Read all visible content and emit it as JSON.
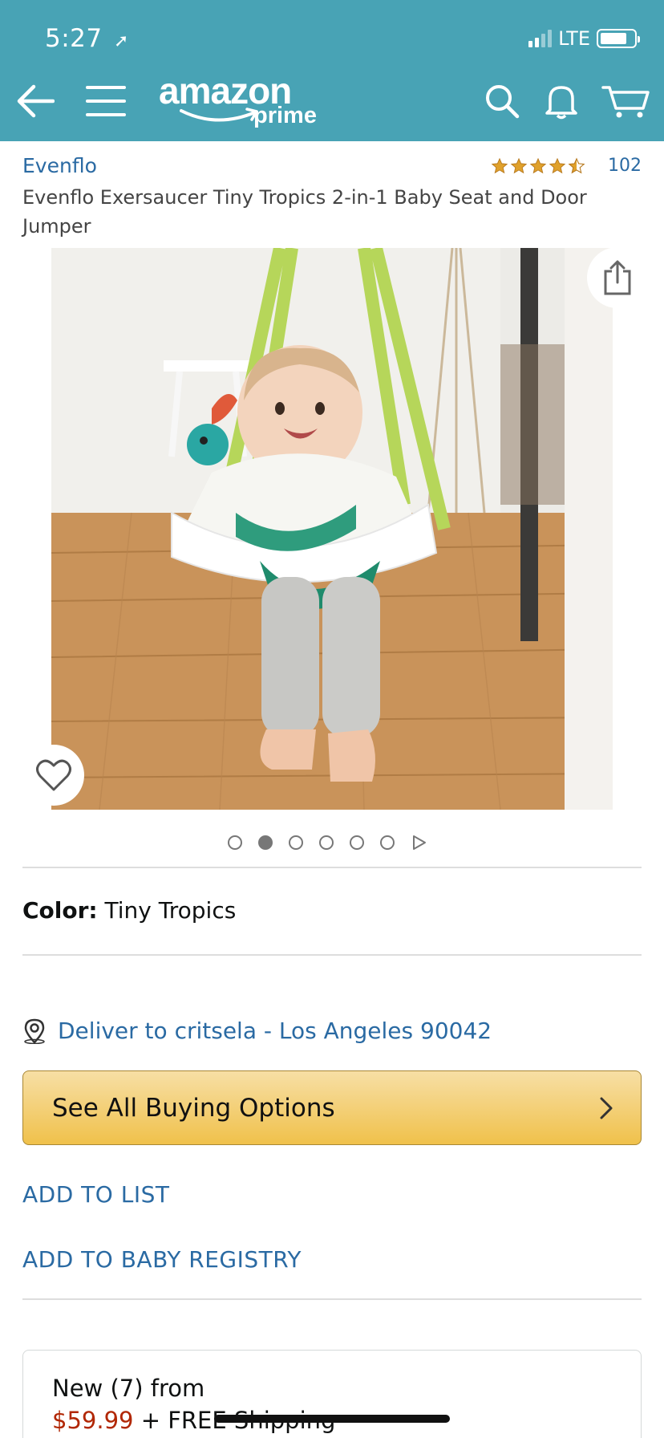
{
  "status_bar": {
    "time": "5:27",
    "location_arrow": "location-arrow-icon",
    "network": "LTE"
  },
  "nav": {
    "back_icon": "back-arrow-icon",
    "menu_icon": "hamburger-menu-icon",
    "logo_text": "amazon",
    "logo_sub": "prime",
    "search_icon": "search-icon",
    "bell_icon": "bell-icon",
    "cart_icon": "cart-icon"
  },
  "product": {
    "brand": "Evenflo",
    "rating": 4.5,
    "rating_count": "102",
    "title": "Evenflo Exersaucer Tiny Tropics 2-in-1 Baby Seat and Door Jumper",
    "image_count": 6,
    "active_image_index": 1
  },
  "color": {
    "label": "Color:",
    "value": "Tiny Tropics"
  },
  "delivery": {
    "text": "Deliver to critsela - Los Angeles 90042"
  },
  "buttons": {
    "buying_options": "See All Buying Options",
    "add_to_list": "ADD TO LIST",
    "add_to_registry": "ADD TO BABY REGISTRY"
  },
  "offer": {
    "line1": "New (7) from",
    "price": "$59.99",
    "shipping": "+ FREE Shipping"
  },
  "colors": {
    "header_bg": "#48a3b5",
    "link": "#2a6aa3",
    "star": "#e0a12b",
    "price": "#b12704",
    "button_top": "#f7dfa5",
    "button_bottom": "#f0c14b"
  }
}
